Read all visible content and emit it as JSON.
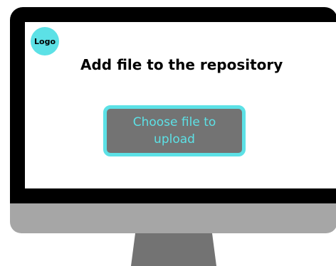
{
  "logo": {
    "label": "Logo"
  },
  "main": {
    "title": "Add file to the repository",
    "upload_button_label": "Choose file to upload"
  },
  "colors": {
    "accent": "#5ce1e6",
    "button_fill": "#737373",
    "bezel": "#000000",
    "chin": "#a6a6a6",
    "stand": "#737373"
  }
}
